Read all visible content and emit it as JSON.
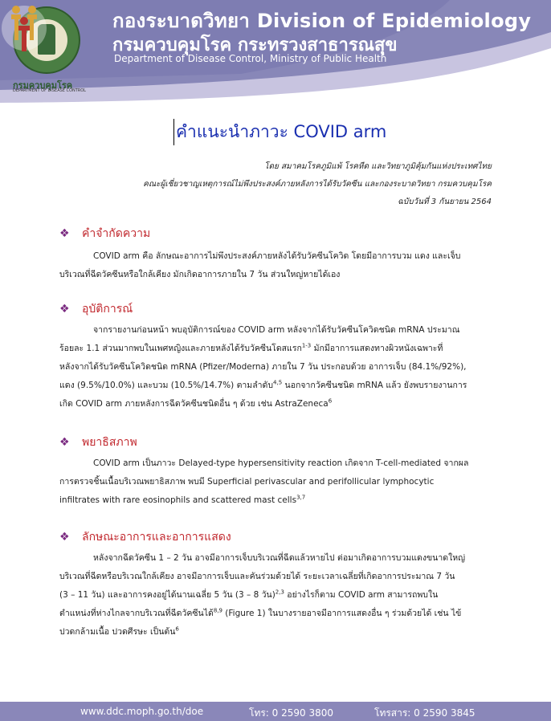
{
  "header": {
    "title_th_line1": "กองระบาดวิทยา Division of Epidemiology",
    "title_th_line2": "กรมควบคุมโรค กระทรวงสาธารณสุข",
    "title_en": "Department of Disease Control, Ministry of Public Health",
    "dept_label": "กรมควบคุมโรค",
    "dept_sublabel": "DEPARTMENT OF DISEASE CONTROL",
    "colors": {
      "band_dark": "#8887b8",
      "band_light": "#c8c4e0",
      "title_blue": "#1a2fb0",
      "heading_red": "#c1272d",
      "bullet_purple": "#7a2a80"
    }
  },
  "document": {
    "title": "คำแนะนำภาวะ COVID arm",
    "byline1": "โดย สมาคมโรคภูมิแพ้ โรคหืด และวิทยาภูมิคุ้มกันแห่งประเทศไทย",
    "byline2": "คณะผู้เชี่ยวชาญเหตุการณ์ไม่พึงประสงค์ภายหลังการได้รับวัคซีน และกองระบาดวิทยา กรมควบคุมโรค",
    "byline3": "ฉบับวันที่ 3 กันยายน 2564"
  },
  "sections": [
    {
      "heading": "คำจำกัดความ",
      "lines": [
        "COVID arm คือ ลักษณะอาการไม่พึงประสงค์ภายหลังได้รับวัคซีนโควิด โดยมีอาการบวม แดง และเจ็บ",
        "บริเวณที่ฉีดวัคซีนหรือใกล้เคียง มักเกิดอาการภายใน 7 วัน ส่วนใหญ่หายได้เอง"
      ]
    },
    {
      "heading": "อุบัติการณ์",
      "lines": [
        "จากรายงานก่อนหน้า พบอุบัติการณ์ของ COVID arm หลังจากได้รับวัคซีนโควิดชนิด mRNA ประมาณ",
        "ร้อยละ 1.1 ส่วนมากพบในเพศหญิงและภายหลังได้รับวัคซีนโดสแรก",
        "หลังจากได้รับวัคซีนโควิดชนิด mRNA (Pfizer/Moderna) ภายใน 7 วัน ประกอบด้วย อาการเจ็บ (84.1%/92%),",
        "แดง (9.5%/10.0%) และบวม (10.5%/14.7%) ตามลำดับ",
        "เกิด COVID arm ภายหลังการฉีดวัคซีนชนิดอื่น ๆ ด้วย เช่น AstraZeneca"
      ],
      "line2_sup": "1-3",
      "line2_tail": " มักมีอาการแสดงทางผิวหนังเฉพาะที่",
      "line4_sup": "4,5",
      "line4_tail": "  นอกจากวัคซีนชนิด mRNA แล้ว ยังพบรายงานการ",
      "line5_sup": "6"
    },
    {
      "heading": "พยาธิสภาพ",
      "lines": [
        "COVID arm เป็นภาวะ Delayed-type hypersensitivity reaction เกิดจาก T-cell-mediated จากผล",
        "การตรวจชิ้นเนื้อบริเวณพยาธิสภาพ พบมี Superficial perivascular and perifollicular lymphocytic",
        "infiltrates with rare eosinophils and scattered mast cells"
      ],
      "line3_sup": "3,7"
    },
    {
      "heading": "ลักษณะอาการและอาการแสดง",
      "lines": [
        "หลังจากฉีดวัคซีน 1 – 2 วัน อาจมีอาการเจ็บบริเวณที่ฉีดแล้วหายไป ต่อมาเกิดอาการบวมแดงขนาดใหญ่",
        "บริเวณที่ฉีดหรือบริเวณใกล้เคียง อาจมีอาการเจ็บและคันร่วมด้วยได้ ระยะเวลาเฉลี่ยที่เกิดอาการประมาณ 7 วัน",
        "(3 – 11 วัน) และอาการคงอยู่ได้นานเฉลี่ย 5 วัน (3 – 8 วัน)",
        "ตำแหน่งที่ห่างไกลจากบริเวณที่ฉีดวัคซีนได้",
        "ปวดกล้ามเนื้อ ปวดศีรษะ เป็นต้น"
      ],
      "line3_sup": "2,3",
      "line3_tail": "  อย่างไรก็ตาม COVID arm สามารถพบใน",
      "line4_sup": "8,9",
      "line4_tail": " (Figure 1) ในบางรายอาจมีอาการแสดงอื่น ๆ ร่วมด้วยได้ เช่น ไข้",
      "line5_sup": "6"
    }
  ],
  "footer": {
    "website": "www.ddc.moph.go.th/doe",
    "phone": "โทร: 0 2590 3800",
    "fax": "โทรสาร: 0 2590 3845"
  }
}
